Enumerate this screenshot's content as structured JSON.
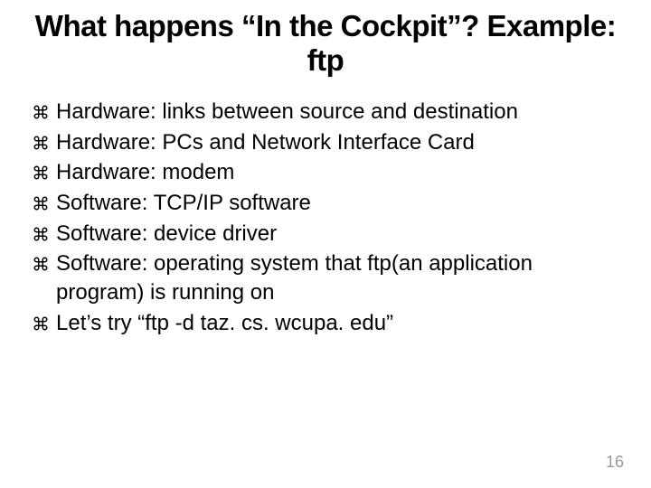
{
  "title": "What happens “In the Cockpit”? Example: ftp",
  "bullets": [
    "Hardware: links between source and destination",
    "Hardware: PCs and Network Interface Card",
    "Hardware: modem",
    "Software: TCP/IP software",
    "Software: device driver",
    "Software: operating system that ftp(an application program) is running on",
    "Let’s try “ftp -d taz. cs. wcupa. edu”"
  ],
  "page_number": "16"
}
